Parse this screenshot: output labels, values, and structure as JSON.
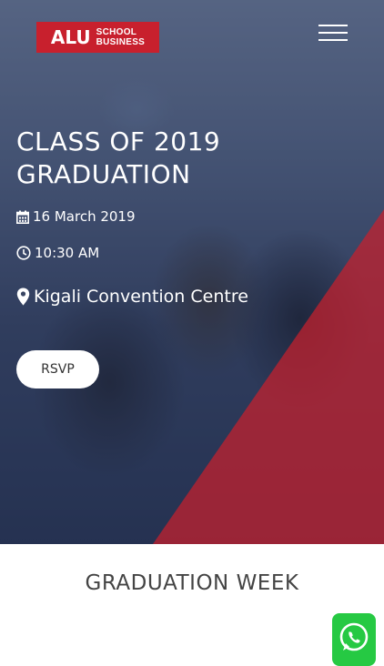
{
  "header": {
    "logo": {
      "primary": "ALU",
      "secondary_line1": "SCHOOL",
      "secondary_line2": "BUSINESS",
      "brand_color": "#c8202d"
    },
    "menu_icon": "hamburger-menu-icon"
  },
  "hero": {
    "title": "CLASS OF 2019 GRADUATION",
    "date": "16 March 2019",
    "time": "10:30 AM",
    "venue": "Kigali Convention Centre",
    "rsvp_label": "RSVP",
    "accent_color": "#c8202d",
    "icons": {
      "date": "calendar-icon",
      "time": "clock-icon",
      "venue": "map-marker-icon"
    }
  },
  "section": {
    "title": "GRADUATION WEEK"
  },
  "floating": {
    "whatsapp_icon": "whatsapp-icon",
    "color": "#26c943"
  }
}
